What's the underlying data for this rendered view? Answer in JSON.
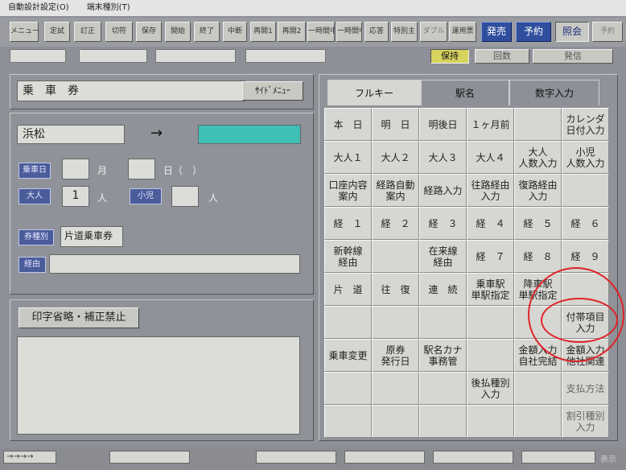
{
  "menu": [
    "自動設計設定(O)",
    "端末種別(T)"
  ],
  "toolbar": {
    "buttons": [
      "メニュー",
      "定試",
      "訂正",
      "切符",
      "保存",
      "開始",
      "終了",
      "中断",
      "再開1",
      "再開2",
      "一時間中",
      "一時間中",
      "応答",
      "特別主",
      "ダブル",
      "運用票",
      "発売",
      "予約",
      "照会",
      "予約"
    ],
    "blue_tabs": [
      "発売",
      "予約",
      "照会"
    ]
  },
  "status_row": {
    "buttons": [
      "保持",
      "回数",
      "発信"
    ]
  },
  "ticket_panel": {
    "title": "乗　車　券",
    "side_menu": "ｻｲﾄﾞﾒﾆｭｰ"
  },
  "route": {
    "from": "浜松",
    "arrow": "→",
    "to": ""
  },
  "fields": {
    "date_label": "乗車日",
    "month_value": "",
    "month_unit": "月",
    "day_value": "",
    "day_unit": "日（　）",
    "adult_label": "大人",
    "adult_value": "1",
    "adult_unit": "人",
    "child_label": "小児",
    "child_value": "",
    "child_unit": "人",
    "ticket_type_label": "券種別",
    "ticket_type_value": "片道乗車券",
    "via_label": "経由",
    "via_value": ""
  },
  "print_panel": {
    "button": "印字省略・補正禁止",
    "memo": ""
  },
  "tabs": [
    "フルキー",
    "駅名",
    "数字入力"
  ],
  "grid": [
    [
      "本　日",
      "明　日",
      "明後日",
      "１ヶ月前",
      "",
      "カレンダ\n日付入力"
    ],
    [
      "大人１",
      "大人２",
      "大人３",
      "大人４",
      "大人\n人数入力",
      "小児\n人数入力"
    ],
    [
      "口座内容\n案内",
      "経路自動\n案内",
      "経路入力",
      "往路経由\n入力",
      "復路経由\n入力",
      ""
    ],
    [
      "経　１",
      "経　２",
      "経　３",
      "経　４",
      "経　５",
      "経　６"
    ],
    [
      "新幹線\n経由",
      "",
      "在来線\n経由",
      "経　７",
      "経　８",
      "経　９"
    ],
    [
      "片　道",
      "往　復",
      "連　続",
      "乗車駅\n単駅指定",
      "降車駅\n単駅指定",
      ""
    ],
    [
      "",
      "",
      "",
      "",
      "",
      "付帯項目\n入力"
    ],
    [
      "乗車変更",
      "原券\n発行日",
      "駅名カナ\n事務管",
      "",
      "金額入力\n自社完結",
      "金額入力\n他社関連"
    ],
    [
      "",
      "",
      "",
      "後払種別\n入力",
      "",
      "支払方法"
    ],
    [
      "",
      "",
      "",
      "",
      "",
      "割引種別\n入力"
    ]
  ],
  "bottom_bar": {
    "arrows": "→→→→",
    "right_text": "表示"
  },
  "colors": {
    "annotation": "#e02428",
    "destination_field": "#3fbfb5",
    "active_tab": "#2f4f9e",
    "selected_button": "#d6d35f"
  }
}
